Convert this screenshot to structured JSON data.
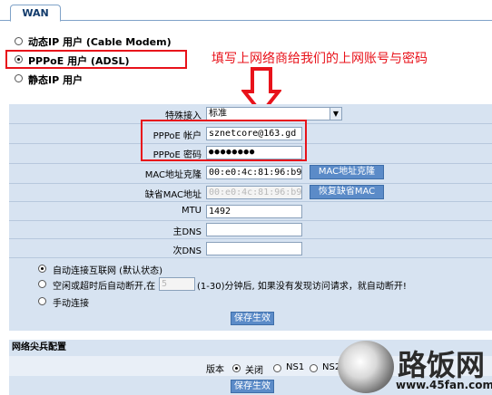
{
  "tab": {
    "label": "WAN"
  },
  "connection_types": [
    {
      "label": "动态IP 用户 (Cable Modem)",
      "selected": false
    },
    {
      "label": "PPPoE 用户 (ADSL)",
      "selected": true
    },
    {
      "label": "静态IP 用户",
      "selected": false
    }
  ],
  "annotation": {
    "text": "填写上网络商给我们的上网账号与密码"
  },
  "form": {
    "special_access": {
      "label": "特殊接入",
      "value": "标准"
    },
    "pppoe_account": {
      "label": "PPPoE 帐户",
      "value": "sznetcore@163.gd"
    },
    "pppoe_password": {
      "label": "PPPoE 密码",
      "value": "●●●●●●●●"
    },
    "mac_clone": {
      "label": "MAC地址克隆",
      "value": "00:e0:4c:81:96:b9",
      "button": "MAC地址克隆"
    },
    "default_mac": {
      "label": "缺省MAC地址",
      "value": "00:e0:4c:81:96:b9",
      "button": "恢复缺省MAC"
    },
    "mtu": {
      "label": "MTU",
      "value": "1492"
    },
    "primary_dns": {
      "label": "主DNS",
      "value": ""
    },
    "secondary_dns": {
      "label": "次DNS",
      "value": ""
    }
  },
  "connect_modes": [
    {
      "label": "自动连接互联网 (默认状态)",
      "selected": true
    },
    {
      "label_before": "空闲或超时后自动断开,在",
      "input_value": "5",
      "label_after": "(1-30)分钟后, 如果没有发现访问请求，就自动断开!",
      "selected": false
    },
    {
      "label": "手动连接",
      "selected": false
    }
  ],
  "save_button": "保存生效",
  "network_section": {
    "title": "网络尖兵配置",
    "version_label": "版本",
    "options": [
      {
        "label": "关闭",
        "selected": true
      },
      {
        "label": "NS1",
        "selected": false
      },
      {
        "label": "NS2",
        "selected": false
      }
    ],
    "save_button": "保存生效"
  },
  "watermark": {
    "brand": "路饭网",
    "url": "www.45fan.com"
  },
  "colors": {
    "highlight_red": "#e8121a",
    "button_blue": "#5b8bc8",
    "panel_blue": "#d7e3f1"
  }
}
